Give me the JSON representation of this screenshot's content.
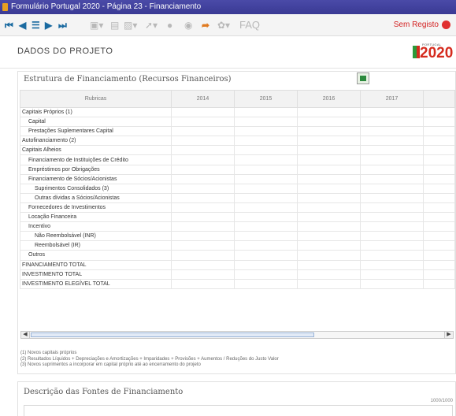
{
  "window": {
    "title": "Formulário Portugal 2020 - Página 23 - Financiamento"
  },
  "toolbar": {
    "nav_icons": [
      "first-page-icon",
      "previous-page-icon",
      "menu-list-icon",
      "next-page-icon",
      "last-page-icon"
    ],
    "status_text": "Sem Registo",
    "status_color": "#e03030"
  },
  "header": {
    "title": "DADOS DO PROJETO",
    "logo_small": "PORTUGAL",
    "logo_year": "2020"
  },
  "financing_table": {
    "title": "Estrutura de Financiamento (Recursos Financeiros)",
    "columns": [
      "Rubricas",
      "2014",
      "2015",
      "2016",
      "2017",
      ""
    ],
    "rows": [
      "Capitais Próprios (1)",
      "Capital",
      "Prestações Suplementares Capital",
      "Autofinanciamento (2)",
      "Capitais Alheios",
      "Financiamento de Instituições de Crédito",
      "Empréstimos por Obrigações",
      "Financiamento de Sócios/Acionistas",
      "Suprimentos Consolidados (3)",
      "Outras dívidas a Sócios/Acionistas",
      "Fornecedores de Investimentos",
      "Locação Financeira",
      "Incentivo",
      "Não Reembolsável (INR)",
      "Reembolsável (IR)",
      "Outros",
      "FINANCIAMENTO TOTAL",
      "INVESTIMENTO TOTAL",
      "INVESTIMENTO ELEGÍVEL TOTAL"
    ]
  },
  "footnotes": [
    "(1) Novos capitais próprios",
    "(2) Resultados Líquidos + Depreciações e Amortizações + Imparidades + Provisões + Aumentos / Reduções do Justo Valor",
    "(3) Novos suprimentos a incorporar em capital próprio até ao encerramento do projeto"
  ],
  "funding_sources": {
    "title": "Descrição das Fontes de Financiamento",
    "counter": "1000/1000"
  }
}
